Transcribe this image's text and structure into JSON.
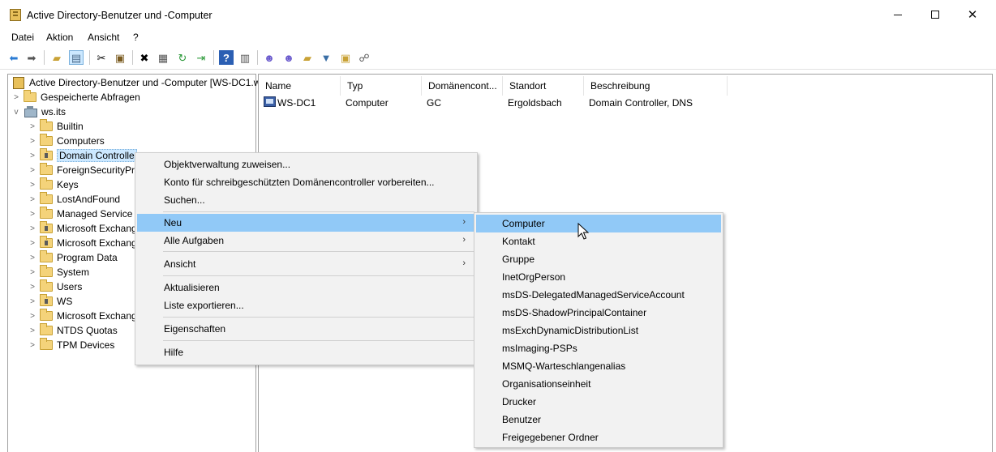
{
  "window": {
    "title": "Active Directory-Benutzer und -Computer"
  },
  "menubar": {
    "items": [
      "Datei",
      "Aktion",
      "Ansicht",
      "?"
    ]
  },
  "toolbar": {
    "buttons": [
      "back-arrow-icon",
      "forward-arrow-icon",
      "up-folder-icon",
      "show-tree-icon",
      "cut-icon",
      "paste-icon",
      "delete-icon",
      "properties-icon",
      "refresh-icon",
      "export-icon",
      "help-icon",
      "console-icon",
      "new-user-icon",
      "new-group-icon",
      "new-ou-icon",
      "filter-icon",
      "find-icon",
      "delegate-icon"
    ]
  },
  "tree": {
    "root": "Active Directory-Benutzer und -Computer [WS-DC1.w",
    "saved_queries": "Gespeicherte Abfragen",
    "domain": "ws.its",
    "items": [
      "Builtin",
      "Computers",
      "Domain Controlle",
      "ForeignSecurityPr",
      "Keys",
      "LostAndFound",
      "Managed Service .",
      "Microsoft Exchang",
      "Microsoft Exchang",
      "Program Data",
      "System",
      "Users",
      "WS",
      "Microsoft Exchang",
      "NTDS Quotas",
      "TPM Devices"
    ]
  },
  "list": {
    "columns": [
      "Name",
      "Typ",
      "Domänencont...",
      "Standort",
      "Beschreibung"
    ],
    "rows": [
      [
        "WS-DC1",
        "Computer",
        "GC",
        "Ergoldsbach",
        "Domain Controller, DNS"
      ]
    ]
  },
  "context_menu": {
    "items": [
      "Objektverwaltung zuweisen...",
      "Konto für schreibgeschützten Domänencontroller vorbereiten...",
      "Suchen...",
      "Neu",
      "Alle Aufgaben",
      "Ansicht",
      "Aktualisieren",
      "Liste exportieren...",
      "Eigenschaften",
      "Hilfe"
    ]
  },
  "submenu": {
    "items": [
      "Computer",
      "Kontakt",
      "Gruppe",
      "InetOrgPerson",
      "msDS-DelegatedManagedServiceAccount",
      "msDS-ShadowPrincipalContainer",
      "msExchDynamicDistributionList",
      "msImaging-PSPs",
      "MSMQ-Warteschlangenalias",
      "Organisationseinheit",
      "Drucker",
      "Benutzer",
      "Freigegebener Ordner"
    ]
  },
  "colors": {
    "highlight": "#91c9f7",
    "selection": "#cce8ff",
    "menu_bg": "#f2f2f2"
  }
}
